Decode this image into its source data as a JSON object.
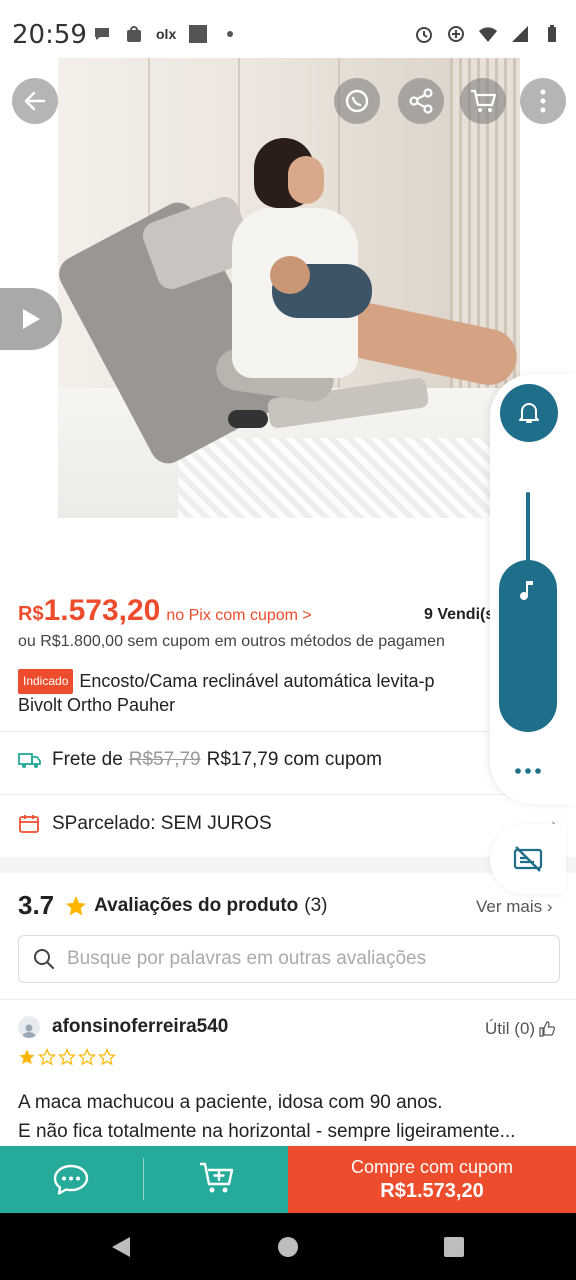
{
  "status_bar": {
    "time": "20:59",
    "olx_label": "olx"
  },
  "hero": {
    "icons": [
      "back-arrow-icon",
      "whatsapp-icon",
      "share-icon",
      "cart-icon",
      "more-vertical-icon",
      "play-icon"
    ]
  },
  "floating_panel": {
    "icons": [
      "bell-icon",
      "music-note-icon",
      "dots-icon",
      "captions-off-icon"
    ],
    "accent_color": "#1f6f8b"
  },
  "product": {
    "currency": "R$",
    "price": "1.573,20",
    "pix_label": "no Pix com cupom >",
    "sold": "9 Vendi(s)",
    "alt_price": "ou R$1.800,00 sem cupom em outros métodos de pagamen",
    "badge": "Indicado",
    "title_line1": "Encosto/Cama reclinável automática levita-p",
    "title_line2": "Bivolt Ortho Pauher"
  },
  "shipping": {
    "prefix": "Frete de",
    "old_price": "R$57,79",
    "new_price": "R$17,79 com cupom"
  },
  "installments": {
    "label": "SParcelado: SEM JUROS"
  },
  "reviews": {
    "rating": "3.7",
    "title": "Avaliações do produto",
    "count": "(3)",
    "see_more": "Ver mais",
    "search_placeholder": "Busque por palavras em outras avaliações",
    "first": {
      "user": "afonsinoferreira540",
      "useful": "Útil (0)",
      "stars": 1,
      "text_line1": "A maca machucou a paciente, idosa com 90 anos.",
      "text_line2": "E não fica totalmente na horizontal - sempre ligeiramente..."
    }
  },
  "bottom_bar": {
    "buy_label": "Compre com cupom",
    "buy_price": "R$1.573,20"
  },
  "colors": {
    "brand": "#ee4d2d",
    "teal": "#26aa99"
  }
}
